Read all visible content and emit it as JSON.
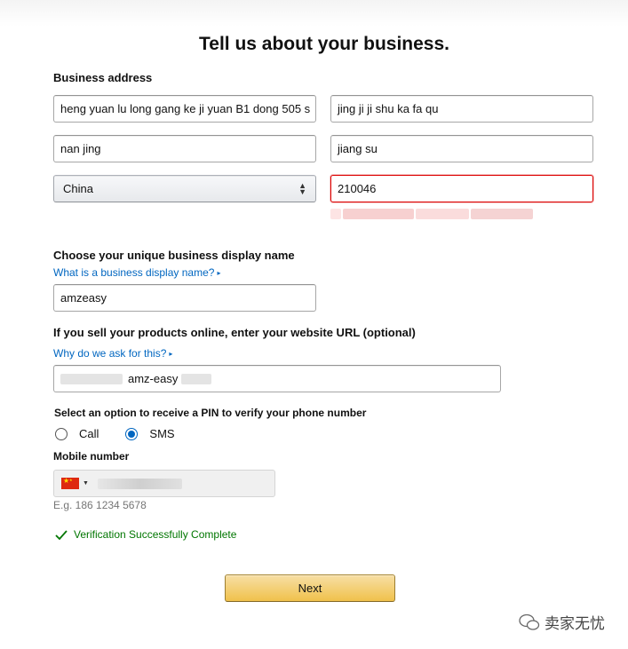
{
  "header": {
    "title": "Tell us about your business."
  },
  "address": {
    "label": "Business address",
    "line1": "heng yuan lu long gang ke ji yuan B1 dong 505 s",
    "line2": "jing ji ji shu ka fa qu",
    "city": "nan jing",
    "state": "jiang su",
    "country": "China",
    "postal_code": "210046"
  },
  "display_name": {
    "label": "Choose your unique business display name",
    "help_link": "What is a business display name?",
    "value": "amzeasy"
  },
  "website": {
    "label": "If you sell your products online, enter your website URL (optional)",
    "help_link": "Why do we ask for this?",
    "value_visible": "amz-easy"
  },
  "pin": {
    "label": "Select an option to receive a PIN to verify your phone number",
    "options": [
      {
        "label": "Call",
        "selected": false
      },
      {
        "label": "SMS",
        "selected": true
      }
    ]
  },
  "mobile": {
    "label": "Mobile number",
    "country_icon": "china-flag-icon",
    "example": "E.g. 186 1234 5678"
  },
  "verification": {
    "message": "Verification Successfully Complete"
  },
  "actions": {
    "next_label": "Next"
  },
  "watermark": {
    "text": "卖家无忧"
  },
  "colors": {
    "link": "#0066c0",
    "success": "#007600",
    "error_border": "#dd0000",
    "button_top": "#f7dfa5",
    "button_bottom": "#f0c14b"
  }
}
